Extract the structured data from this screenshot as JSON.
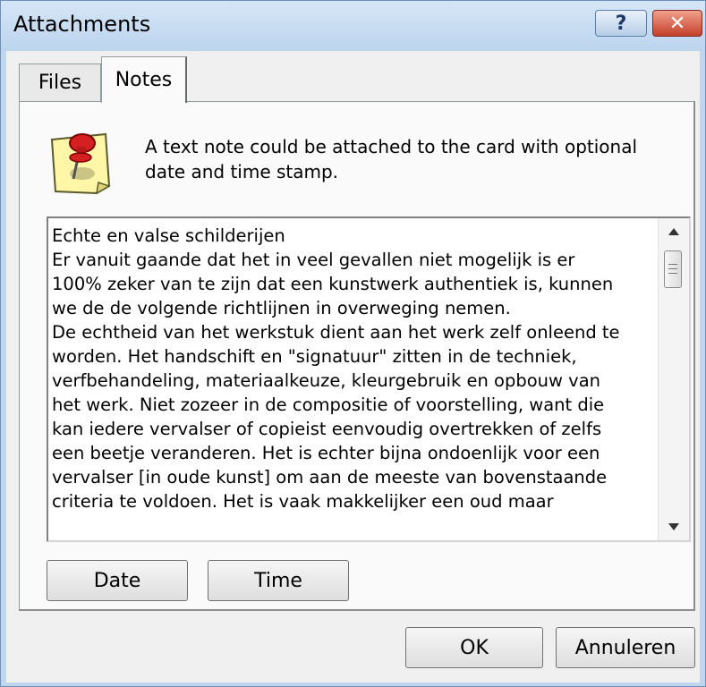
{
  "window": {
    "title": "Attachments",
    "help_label": "?",
    "close_label": "✕"
  },
  "tabs": [
    {
      "label": "Files",
      "active": false
    },
    {
      "label": "Notes",
      "active": true
    }
  ],
  "notes_tab": {
    "icon": "pinned-note-icon",
    "description": "A text note could be attached to the card with optional date and time stamp.",
    "note_lines": [
      "Echte en valse schilderijen",
      "Er vanuit gaande dat het in veel gevallen niet mogelijk is er 100% zeker van te zijn dat een kunstwerk authentiek is, kunnen we de de volgende richtlijnen in overweging nemen.",
      "De echtheid van het werkstuk dient aan  het werk zelf onleend te worden.  Het handschift en \"signatuur\" zitten in de techniek, verfbehandeling, materiaalkeuze, kleurgebruik en opbouw van het werk. Niet zozeer in de compositie of voorstelling, want die kan iedere vervalser of copieist eenvoudig overtrekken of zelfs een beetje veranderen. Het is echter bijna ondoenlijk voor een vervalser [in oude kunst] om aan de meeste van bovenstaande criteria te voldoen. Het is vaak makkelijker een oud maar"
    ],
    "date_button": "Date",
    "time_button": "Time"
  },
  "footer": {
    "ok_label": "OK",
    "cancel_label": "Annuleren"
  },
  "colors": {
    "title_bar": "#bcd4ee",
    "close_button": "#c4402a",
    "dialog_face": "#f0f0f0"
  }
}
